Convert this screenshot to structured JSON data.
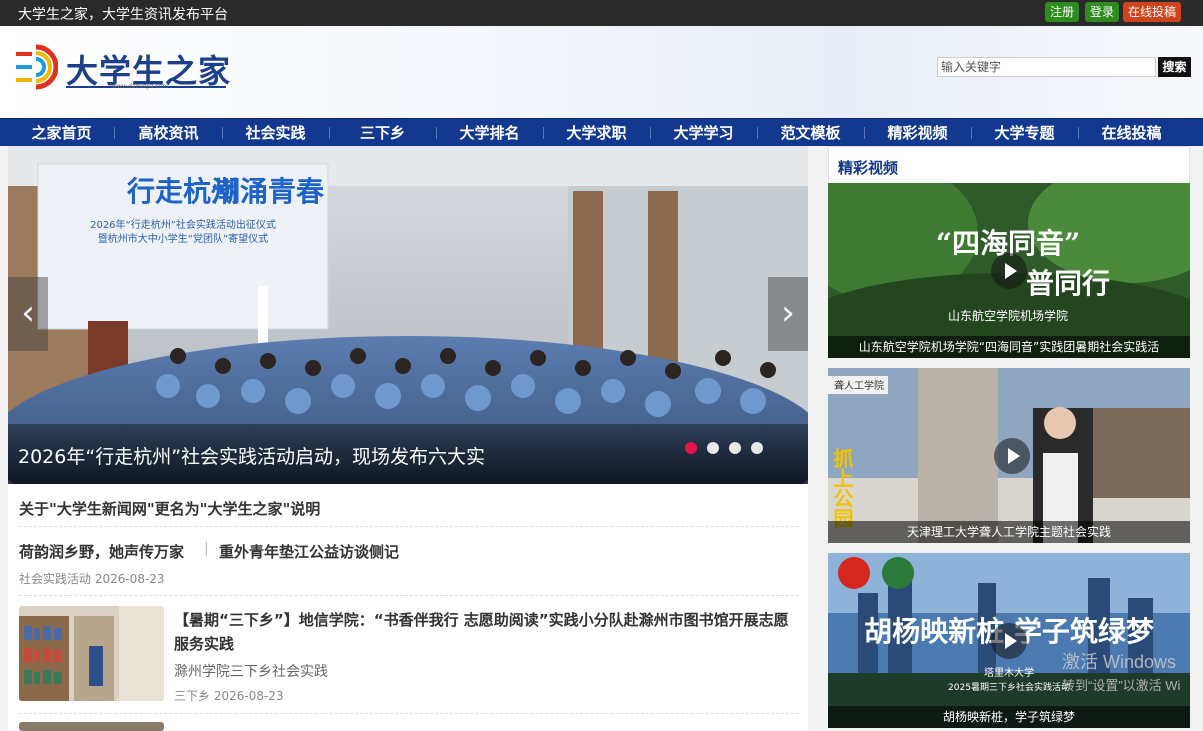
{
  "topbar": {
    "slogan": "大学生之家，大学生资讯发布平台",
    "register": "注册",
    "login": "登录",
    "submit": "在线投稿"
  },
  "header": {
    "site_name": "大学生之家",
    "site_url": "www.daxuejia.com",
    "search_placeholder": "输入关键字",
    "search_button": "搜索"
  },
  "nav": [
    "之家首页",
    "高校资讯",
    "社会实践",
    "三下乡",
    "大学排名",
    "大学求职",
    "大学学习",
    "范文模板",
    "精彩视频",
    "大学专题",
    "在线投稿"
  ],
  "slider": {
    "caption": "2026年“行走杭州”社会实践活动启动，现场发布六大实",
    "screen_title_1": "行走杭州",
    "screen_title_2": "潮涌青春",
    "screen_sub_1": "2026年“行走杭州”社会实践活动出征仪式",
    "screen_sub_2": "暨杭州市大中小学生“党团队”寄望仪式",
    "active_index": 1,
    "total": 4
  },
  "news": [
    {
      "title": "关于\"大学生新闻网\"更名为\"大学生之家\"说明"
    },
    {
      "title": "荷韵润乡野，她声传万家",
      "title2": "重外青年垫江公益访谈侧记",
      "meta": "社会实践活动 2026-08-23"
    },
    {
      "title": "【暑期“三下乡”】地信学院：“书香伴我行 志愿助阅读”实践小分队赴滁州市图书馆开展志愿服务实践",
      "desc": "滁州学院三下乡社会实践",
      "meta": "三下乡 2026-08-23"
    }
  ],
  "aside": {
    "title": "精彩视频",
    "videos": [
      {
        "caption": "山东航空学院机场学院“四海同音”实践团暑期社会实践活",
        "art_line1": "“四海同音”",
        "art_line2": "普同行",
        "art_sub": "山东航空学院机场学院"
      },
      {
        "caption": "天津理工大学聋人工学院主题社会实践",
        "art_label": "聋人工学院",
        "art_side": "抓上公园"
      },
      {
        "caption": "胡杨映新桩，学子筑绿梦",
        "art_line1": "胡杨映新桩 学子筑绿梦",
        "art_sub": "2025暑期三下乡社会实践活动",
        "art_org": "塔里木大学"
      }
    ]
  },
  "watermark": {
    "line1": "激活 Windows",
    "line2": "转到“设置”以激活 Wi"
  },
  "colors": {
    "nav_bg": "#12388f",
    "register": "#2e8b1e",
    "login": "#2e8b1e",
    "submit": "#d0421b",
    "active_dot": "#e5154a"
  }
}
